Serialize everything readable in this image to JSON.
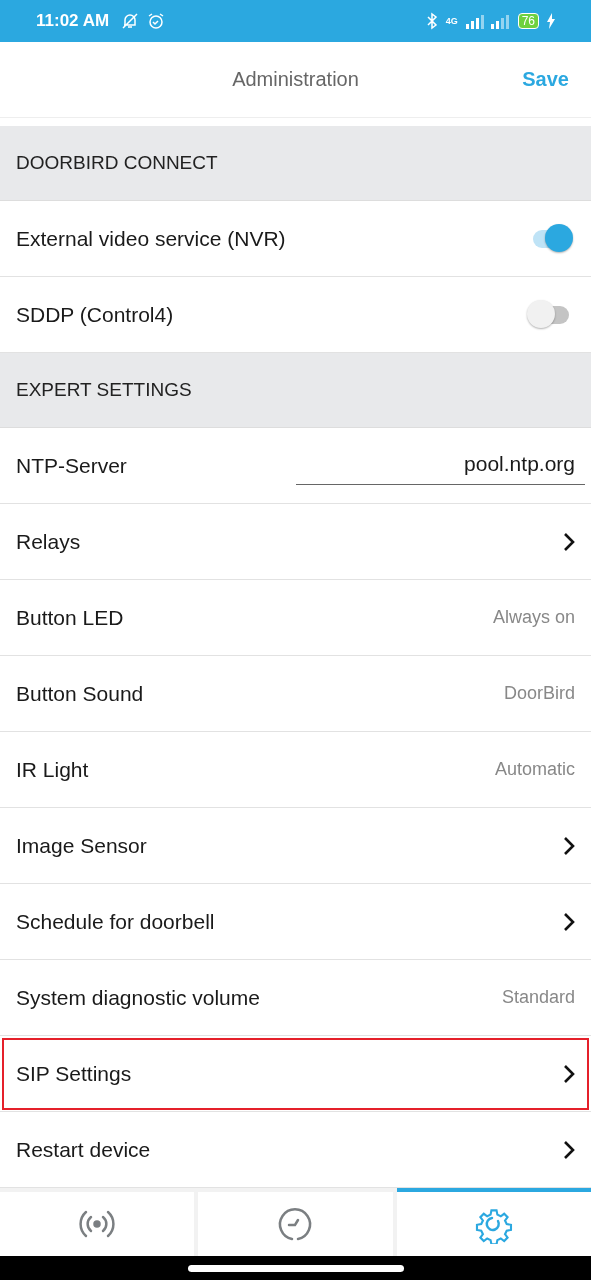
{
  "status_bar": {
    "time": "11:02 AM",
    "network": "4G",
    "battery": "76"
  },
  "header": {
    "title": "Administration",
    "action": "Save"
  },
  "sections": [
    {
      "title": "DOORBIRD CONNECT",
      "rows": [
        {
          "kind": "toggle",
          "label": "External video service (NVR)",
          "on": true,
          "highlighted": false
        },
        {
          "kind": "toggle",
          "label": "SDDP (Control4)",
          "on": false,
          "highlighted": false
        }
      ]
    },
    {
      "title": "EXPERT SETTINGS",
      "rows": [
        {
          "kind": "input",
          "label": "NTP-Server",
          "value": "pool.ntp.org",
          "highlighted": false
        },
        {
          "kind": "chevron",
          "label": "Relays",
          "highlighted": false
        },
        {
          "kind": "value",
          "label": "Button LED",
          "value": "Always on",
          "highlighted": false
        },
        {
          "kind": "value",
          "label": "Button Sound",
          "value": "DoorBird",
          "highlighted": false
        },
        {
          "kind": "value",
          "label": "IR Light",
          "value": "Automatic",
          "highlighted": false
        },
        {
          "kind": "chevron",
          "label": "Image Sensor",
          "highlighted": false
        },
        {
          "kind": "chevron",
          "label": "Schedule for doorbell",
          "highlighted": false
        },
        {
          "kind": "value",
          "label": "System diagnostic volume",
          "value": "Standard",
          "highlighted": false
        },
        {
          "kind": "chevron",
          "label": "SIP Settings",
          "highlighted": true
        },
        {
          "kind": "chevron",
          "label": "Restart device",
          "highlighted": false
        }
      ]
    }
  ],
  "tabs": [
    {
      "kind": "live",
      "selected": false
    },
    {
      "kind": "history",
      "selected": false
    },
    {
      "kind": "settings",
      "selected": true
    }
  ]
}
